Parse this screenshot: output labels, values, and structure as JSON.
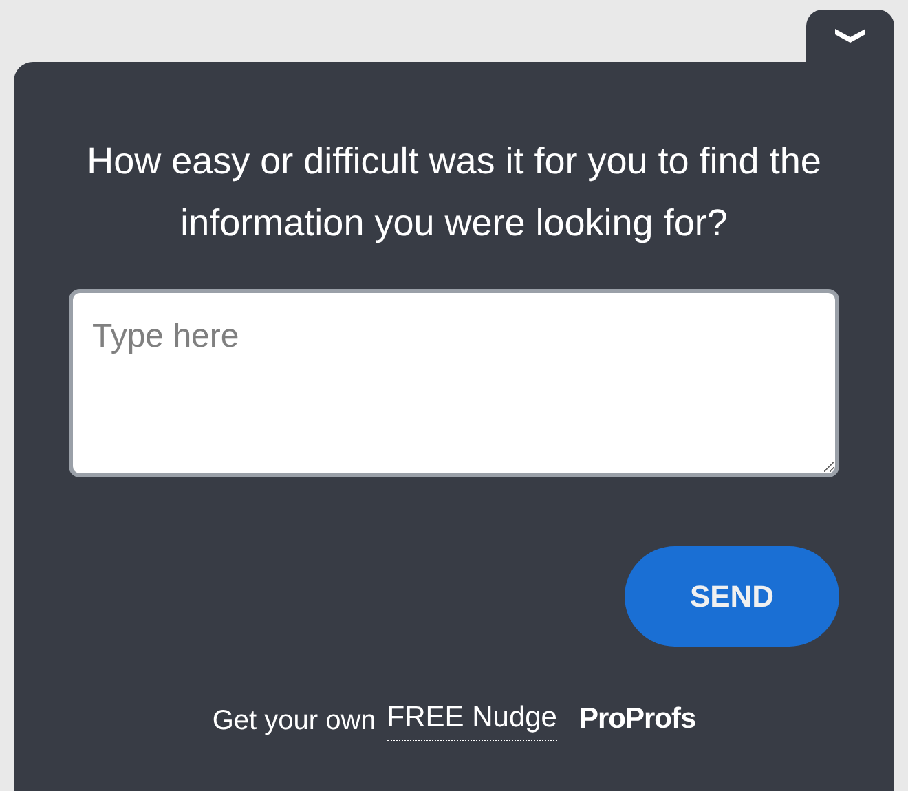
{
  "question": "How easy or difficult was it for you to find the information you were looking for?",
  "answer": {
    "placeholder": "Type here"
  },
  "send_button": "SEND",
  "footer": {
    "text": "Get your own",
    "link": "FREE Nudge",
    "brand": "ProProfs"
  }
}
